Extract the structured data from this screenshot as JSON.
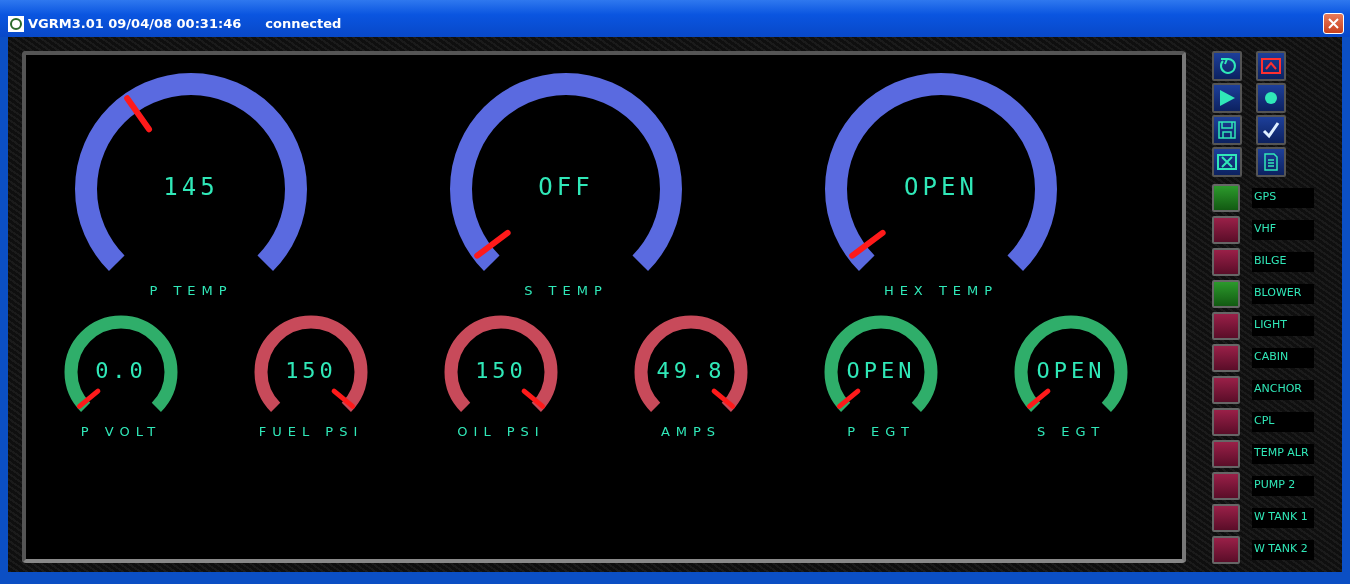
{
  "window": {
    "title": "VGRM3.01 09/04/08 00:31:46",
    "status": "connected"
  },
  "large_gauges": [
    {
      "label": "P TEMP",
      "reading": "145",
      "color": "#5a6ae0"
    },
    {
      "label": "S TEMP",
      "reading": "OFF",
      "color": "#5a6ae0"
    },
    {
      "label": "HEX TEMP",
      "reading": "OPEN",
      "color": "#5a6ae0"
    }
  ],
  "small_gauges": [
    {
      "label": "P VOLT",
      "reading": "0.0",
      "color": "#2fae6a"
    },
    {
      "label": "FUEL PSI",
      "reading": "150",
      "color": "#c84a5a"
    },
    {
      "label": "OIL PSI",
      "reading": "150",
      "color": "#c84a5a"
    },
    {
      "label": "AMPS",
      "reading": "49.8",
      "color": "#c84a5a"
    },
    {
      "label": "P EGT",
      "reading": "OPEN",
      "color": "#2fae6a"
    },
    {
      "label": "S EGT",
      "reading": "OPEN",
      "color": "#2fae6a"
    }
  ],
  "toolbar": [
    {
      "kind": "refresh"
    },
    {
      "kind": "up"
    },
    {
      "kind": "play"
    },
    {
      "kind": "record"
    },
    {
      "kind": "save"
    },
    {
      "kind": "check"
    },
    {
      "kind": "close"
    },
    {
      "kind": "document"
    }
  ],
  "indicators": [
    {
      "label": "GPS",
      "on": true
    },
    {
      "label": "VHF",
      "on": false
    },
    {
      "label": "BILGE",
      "on": false
    },
    {
      "label": "BLOWER",
      "on": true
    },
    {
      "label": "LIGHT",
      "on": false
    },
    {
      "label": "CABIN",
      "on": false
    },
    {
      "label": "ANCHOR",
      "on": false
    },
    {
      "label": "CPL",
      "on": false
    },
    {
      "label": "TEMP ALR",
      "on": false
    },
    {
      "label": "PUMP 2",
      "on": false
    },
    {
      "label": "W TANK 1",
      "on": false
    },
    {
      "label": "W TANK 2",
      "on": false
    }
  ]
}
